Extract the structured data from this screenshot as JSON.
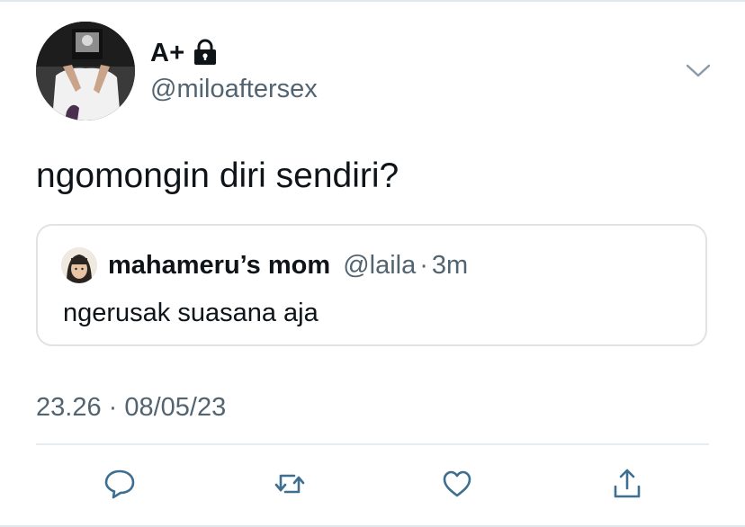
{
  "tweet": {
    "display_name": "A+",
    "handle": "@miloaftersex",
    "text": "ngomongin diri sendiri?",
    "timestamp": "23.26 · 08/05/23"
  },
  "quoted_tweet": {
    "display_name": "mahameru’s mom",
    "handle": "@laila",
    "separator": "·",
    "age": "3m",
    "text": "ngerusak suasana aja"
  },
  "icons": {
    "lock": "lock-icon",
    "more": "chevron-down-icon",
    "reply": "reply-icon",
    "retweet": "retweet-icon",
    "like": "heart-icon",
    "share": "share-icon"
  },
  "colors": {
    "text": "#0f1419",
    "muted": "#536471",
    "icon": "#3e6e90",
    "border": "#dfe3e6"
  }
}
